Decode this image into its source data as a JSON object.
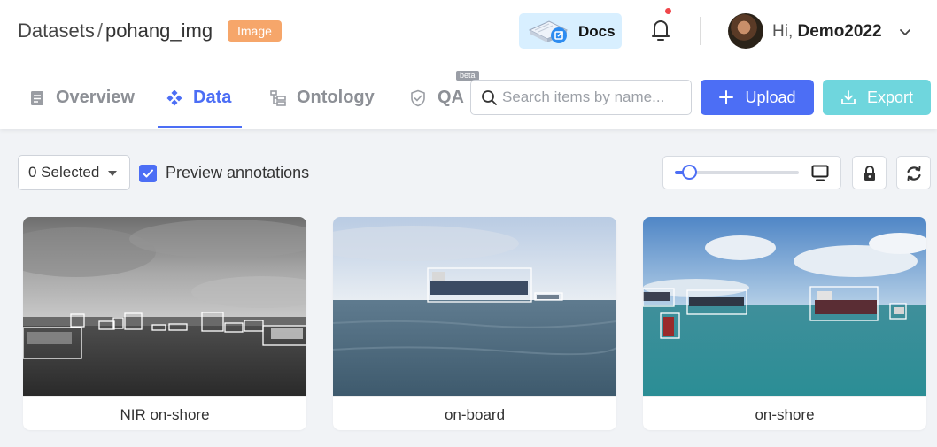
{
  "header": {
    "breadcrumb_root": "Datasets",
    "breadcrumb_sep": "/",
    "breadcrumb_current": "pohang_img",
    "type_badge": "Image",
    "docs_label": "Docs",
    "greeting_prefix": "Hi,",
    "username": "Demo2022",
    "icons": [
      "docs-book-icon",
      "bell-icon",
      "chevron-down-icon"
    ]
  },
  "tabs": [
    {
      "label": "Overview",
      "icon": "document-icon",
      "active": false
    },
    {
      "label": "Data",
      "icon": "diamond-grid-icon",
      "active": true
    },
    {
      "label": "Ontology",
      "icon": "hierarchy-icon",
      "active": false
    },
    {
      "label": "QA",
      "icon": "shield-check-icon",
      "active": false,
      "tag": "beta"
    }
  ],
  "search": {
    "placeholder": "Search items by name..."
  },
  "actions": {
    "upload_label": "Upload",
    "export_label": "Export"
  },
  "toolbar": {
    "selected_label": "0 Selected",
    "preview_annotations_label": "Preview annotations",
    "preview_annotations_checked": true,
    "zoom_level": 0.12
  },
  "items": [
    {
      "caption": "NIR on-shore"
    },
    {
      "caption": "on-board"
    },
    {
      "caption": "on-shore"
    }
  ],
  "colors": {
    "accent": "#4c6ef5",
    "export": "#6fd6dd",
    "badge": "#f6a66a",
    "docs_bg": "#d8efff",
    "notification_dot": "#f0464a"
  }
}
